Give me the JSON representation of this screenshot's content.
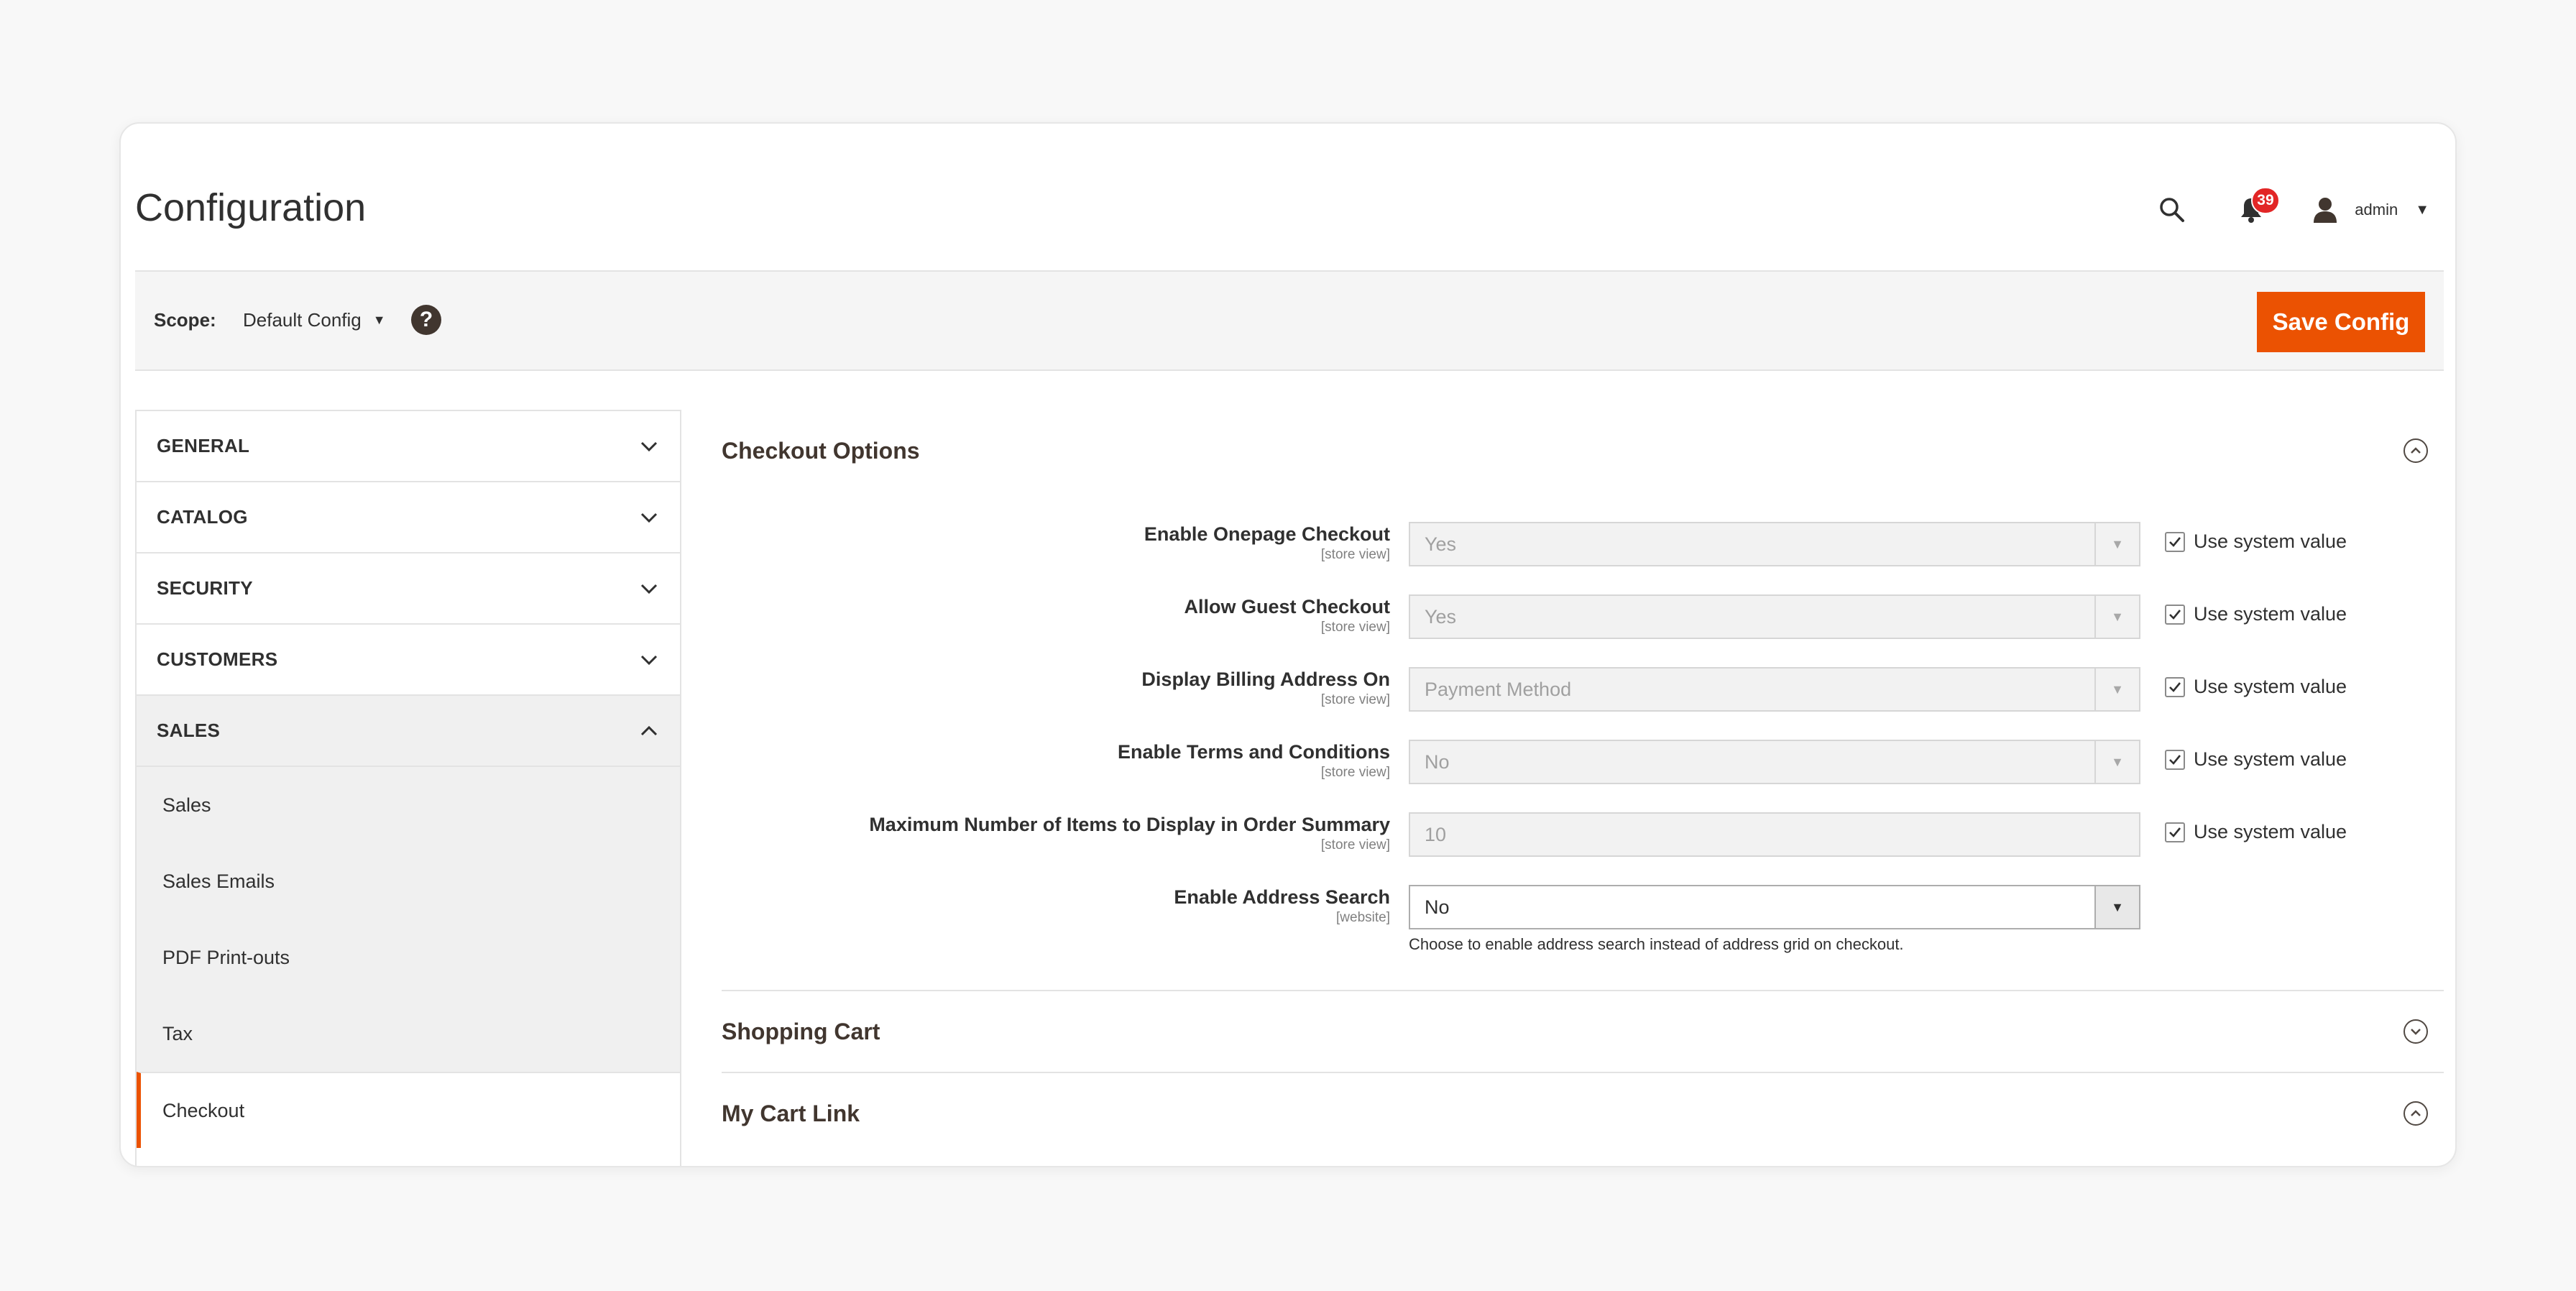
{
  "header": {
    "title": "Configuration",
    "notifications_count": "39",
    "user_name": "admin",
    "icons": [
      "search-icon",
      "bell-icon",
      "user-icon",
      "caret-down-icon"
    ]
  },
  "scope_bar": {
    "label": "Scope:",
    "value": "Default Config",
    "help": "?",
    "save_label": "Save Config"
  },
  "sidebar": {
    "groups": [
      {
        "title": "GENERAL"
      },
      {
        "title": "CATALOG"
      },
      {
        "title": "SECURITY"
      },
      {
        "title": "CUSTOMERS"
      },
      {
        "title": "SALES"
      }
    ],
    "sales_items": [
      "Sales",
      "Sales Emails",
      "PDF Print-outs",
      "Tax",
      "Checkout"
    ]
  },
  "main": {
    "sections": [
      {
        "title": "Checkout Options"
      },
      {
        "title": "Shopping Cart"
      },
      {
        "title": "My Cart Link"
      }
    ],
    "use_system_label": "Use system value",
    "fields": [
      {
        "label": "Enable Onepage Checkout",
        "scope": "[store view]",
        "value": "Yes"
      },
      {
        "label": "Allow Guest Checkout",
        "scope": "[store view]",
        "value": "Yes"
      },
      {
        "label": "Display Billing Address On",
        "scope": "[store view]",
        "value": "Payment Method"
      },
      {
        "label": "Enable Terms and Conditions",
        "scope": "[store view]",
        "value": "No"
      },
      {
        "label": "Maximum Number of Items to Display in Order Summary",
        "scope": "[store view]",
        "value": "10"
      },
      {
        "label": "Enable Address Search",
        "scope": "[website]",
        "value": "No",
        "note": "Choose to enable address search instead of address grid on checkout."
      }
    ]
  },
  "colors": {
    "accent": "#eb5202",
    "badge": "#e22626",
    "text": "#303030",
    "section_title": "#41362f"
  }
}
